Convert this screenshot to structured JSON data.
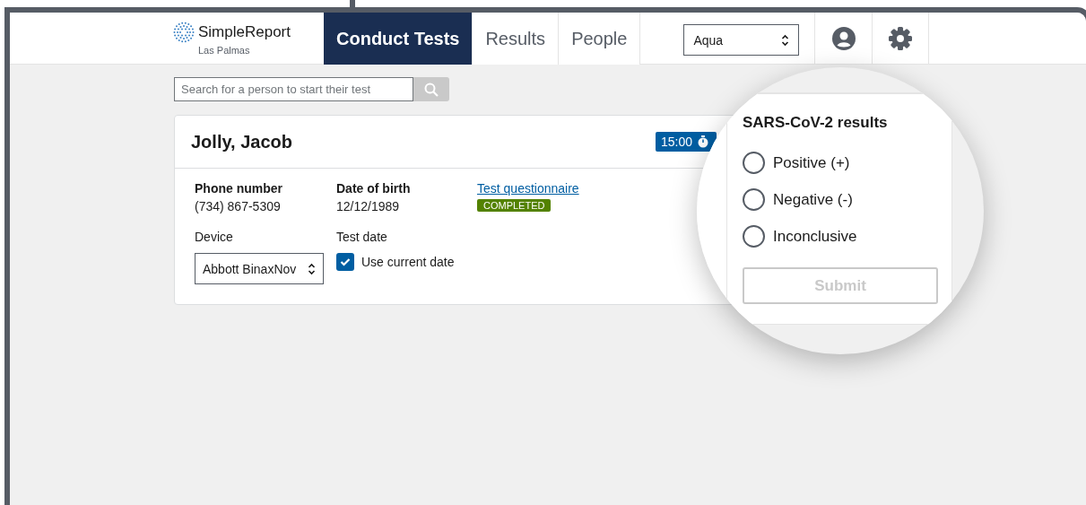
{
  "app": {
    "logo": "SimpleReport",
    "facility": "Las Palmas"
  },
  "nav": [
    {
      "label": "Conduct Tests",
      "selected": true
    },
    {
      "label": "Results",
      "selected": false
    },
    {
      "label": "People",
      "selected": false
    }
  ],
  "facility_select": {
    "value": "Aqua"
  },
  "search": {
    "placeholder": "Search for a person to start their test"
  },
  "patient": {
    "name": "Jolly, Jacob",
    "timer": "15:00",
    "fields": [
      {
        "label": "Phone number",
        "value": "(734) 867-5309"
      },
      {
        "label": "Date of birth",
        "value": "12/12/1989"
      }
    ],
    "questionnaire": {
      "link": "Test questionnaire",
      "status": "COMPLETED"
    },
    "device": {
      "label": "Device",
      "value": "Abbott BinaxNov"
    },
    "test_date": {
      "label": "Test date",
      "checkbox": "Use current date",
      "checked": true
    }
  },
  "results": {
    "title": "SARS-CoV-2 results",
    "options": [
      {
        "label": "Positive (+)",
        "selected": false
      },
      {
        "label": "Negative (-)",
        "selected": false
      },
      {
        "label": "Inconclusive",
        "selected": false
      }
    ],
    "submit": {
      "label": "Submit",
      "disabled": true
    }
  }
}
